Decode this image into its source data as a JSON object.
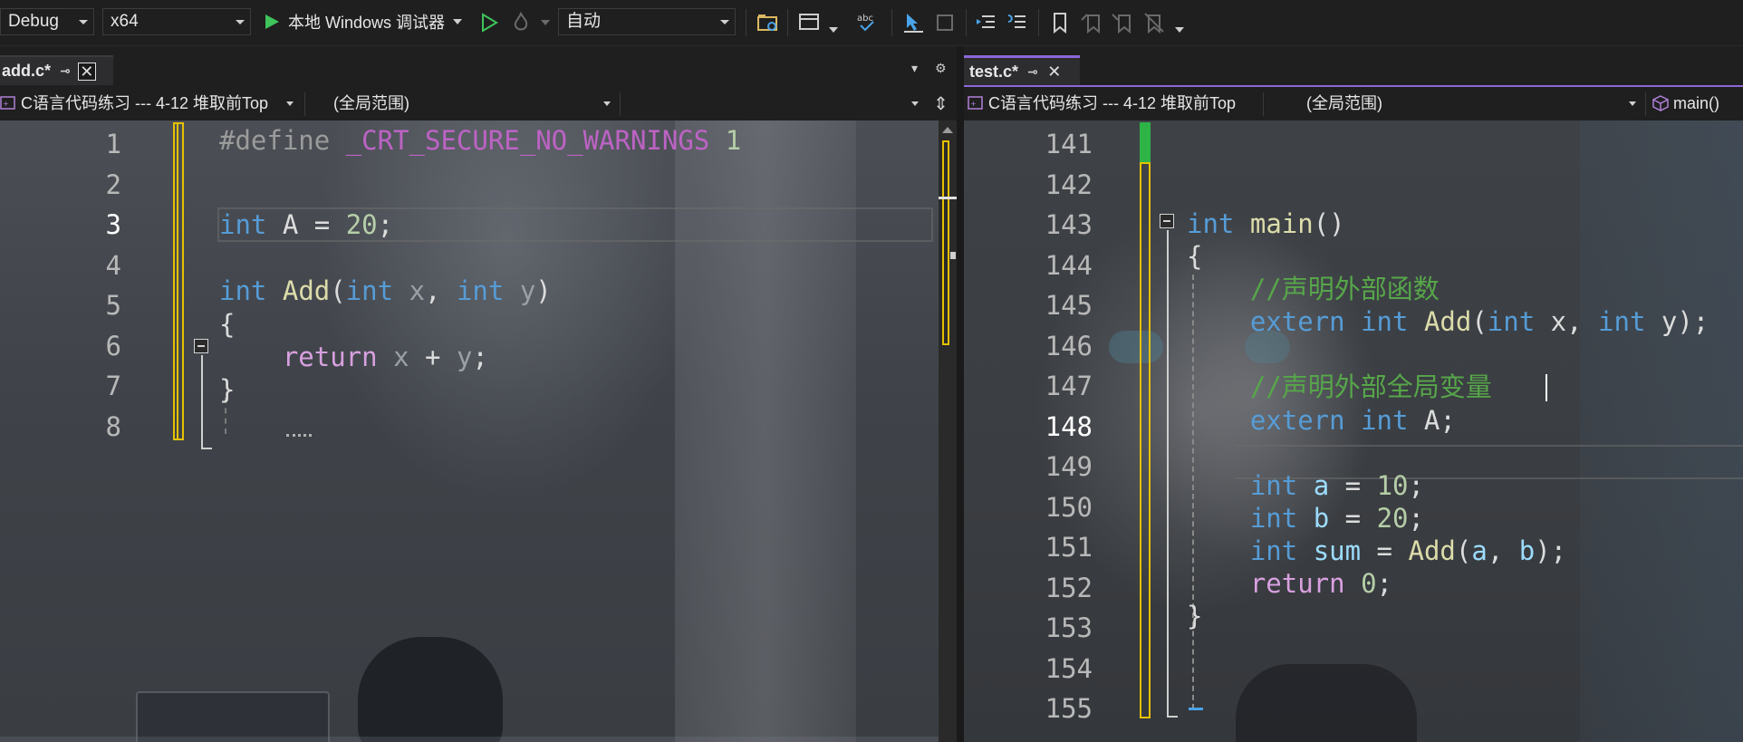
{
  "toolbar": {
    "config": "Debug",
    "platform": "x64",
    "run_label": "本地 Windows 调试器",
    "mode": "自动",
    "icons": [
      "play-icon",
      "play-outline-icon",
      "fire-icon",
      "folder-icon",
      "window-layout-icon",
      "spellcheck-icon",
      "cursor-select-icon",
      "outdent-icon",
      "indent-icon",
      "comment-icon",
      "bookmark-icon",
      "bookmark-prev-icon",
      "bookmark-next-icon",
      "bookmark-clear-icon",
      "overflow-icon"
    ]
  },
  "left_pane": {
    "tab_name": "add.c*",
    "nav_project": "C语言代码练习 --- 4-12 堆取前Top",
    "nav_scope": "(全局范围)",
    "nav_member": "",
    "line_numbers": [
      "1",
      "2",
      "3",
      "4",
      "5",
      "6",
      "7",
      "8"
    ]
  },
  "right_pane": {
    "tab_name": "test.c*",
    "nav_project": "C语言代码练习 --- 4-12 堆取前Top",
    "nav_scope": "(全局范围)",
    "nav_member": "main()",
    "line_numbers": [
      "141",
      "142",
      "143",
      "144",
      "145",
      "146",
      "147",
      "148",
      "149",
      "150",
      "151",
      "152",
      "153",
      "154",
      "155"
    ]
  },
  "colors": {
    "keyword": "#569cd6",
    "function": "#dcdcaa",
    "comment": "#57a64a",
    "number": "#b5cea8",
    "variable": "#9cdcfe",
    "control": "#d8a0df",
    "modified_bar": "#e5c100",
    "saved_bar": "#2eb346",
    "tab_accent": "#8c68d8"
  }
}
